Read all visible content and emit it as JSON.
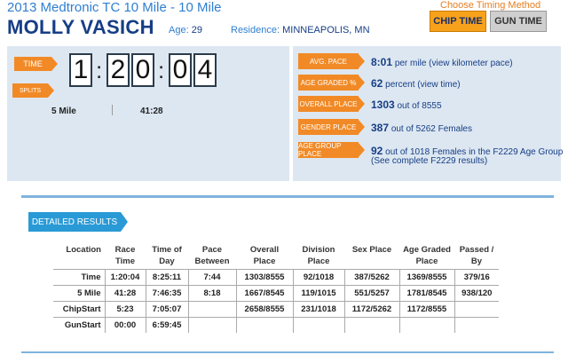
{
  "header": {
    "race_title": "2013 Medtronic TC 10 Mile - 10 Mile",
    "runner_name": "MOLLY VASICH",
    "age_label": "Age:",
    "age_value": "29",
    "residence_label": "Residence:",
    "residence_value": "MINNEAPOLIS, MN"
  },
  "timing": {
    "title": "Choose Timing Method",
    "chip_label": "CHIP TIME",
    "gun_label": "GUN TIME"
  },
  "time_panel": {
    "time_tag": "TIME",
    "digits": [
      "1",
      "2",
      "0",
      "0",
      "4"
    ],
    "splits_tag": "SPLITS",
    "split_name": "5 Mile",
    "split_time": "41:28"
  },
  "stats": {
    "pace": {
      "tag": "AVG. PACE",
      "value": "8:01",
      "text": "per mile (view kilometer pace)"
    },
    "age_graded": {
      "tag": "AGE GRADED %",
      "value": "62",
      "text": "percent (view time)"
    },
    "overall": {
      "tag": "OVERALL PLACE",
      "value": "1303",
      "text": "out of 8555"
    },
    "gender": {
      "tag": "GENDER PLACE",
      "value": "387",
      "text": "out of 5262 Females"
    },
    "age_group": {
      "tag": "AGE GROUP PLACE",
      "value": "92",
      "text": "out of 1018 Females in the F2229 Age Group",
      "sub": "(See complete F2229 results)"
    }
  },
  "results": {
    "tag": "DETAILED RESULTS",
    "columns": [
      "Location",
      "Race Time",
      "Time of Day",
      "Pace Between",
      "Overall Place",
      "Division Place",
      "Sex Place",
      "Age Graded Place",
      "Passed / By"
    ],
    "rows": [
      [
        "Time",
        "1:20:04",
        "8:25:11",
        "7:44",
        "1303/8555",
        "92/1018",
        "387/5262",
        "1369/8555",
        "379/16"
      ],
      [
        "5 Mile",
        "41:28",
        "7:46:35",
        "8:18",
        "1667/8545",
        "119/1015",
        "551/5257",
        "1781/8545",
        "938/120"
      ],
      [
        "ChipStart",
        "5:23",
        "7:05:07",
        "",
        "2658/8555",
        "231/1018",
        "1172/5262",
        "1172/8555",
        ""
      ],
      [
        "GunStart",
        "00:00",
        "6:59:45",
        "",
        "",
        "",
        "",
        "",
        ""
      ]
    ]
  }
}
